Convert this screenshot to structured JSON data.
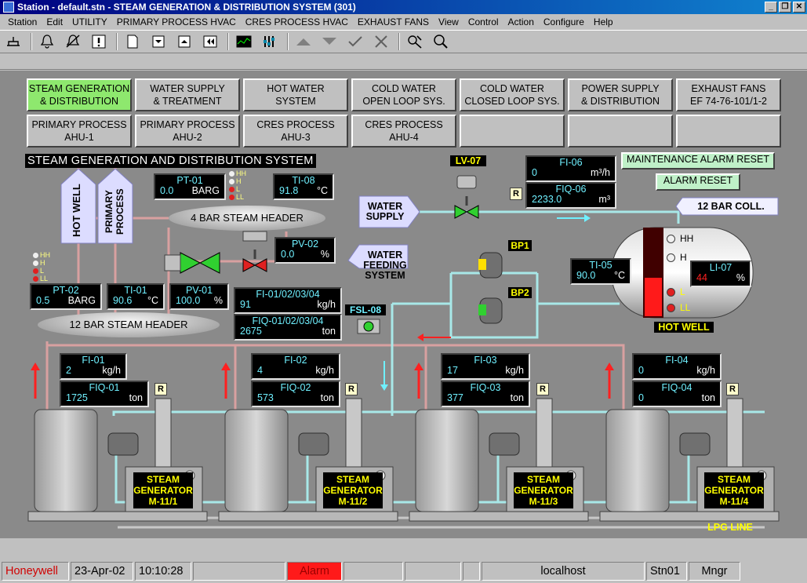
{
  "window": {
    "title": "Station - default.stn - STEAM GENERATION & DISTRIBUTION SYSTEM (301)",
    "controls": [
      "_",
      "❐",
      "✕"
    ]
  },
  "menu": [
    "Station",
    "Edit",
    "UTILITY",
    "PRIMARY PROCESS HVAC",
    "CRES PROCESS HVAC",
    "EXHAUST FANS",
    "View",
    "Control",
    "Action",
    "Configure",
    "Help"
  ],
  "toolbar": [
    "network-icon",
    "bell-icon",
    "bell-mute-icon",
    "alert-icon",
    "page-icon",
    "page-down-icon",
    "page-up-icon",
    "page-back-icon",
    "trend-icon",
    "bars-icon",
    "arrow-up-icon",
    "arrow-down-icon",
    "check-icon",
    "cross-icon",
    "detail-icon",
    "search-icon"
  ],
  "nav": {
    "row1": [
      "STEAM GENERATION\n& DISTRIBUTION",
      "WATER SUPPLY\n& TREATMENT",
      "HOT WATER\nSYSTEM",
      "COLD WATER\nOPEN LOOP SYS.",
      "COLD WATER\nCLOSED LOOP SYS.",
      "POWER SUPPLY\n& DISTRIBUTION",
      "EXHAUST FANS\nEF 74-76-101/1-2"
    ],
    "row2": [
      "PRIMARY PROCESS\nAHU-1",
      "PRIMARY PROCESS\nAHU-2",
      "CRES PROCESS\nAHU-3",
      "CRES PROCESS\nAHU-4",
      "",
      "",
      ""
    ]
  },
  "system_title": "STEAM GENERATION AND DISTRIBUTION SYSTEM",
  "buttons": {
    "maint_reset": "MAINTENANCE ALARM RESET",
    "alarm_reset": "ALARM RESET"
  },
  "labels": {
    "hot_well_arrow": "HOT WELL",
    "primary_process_arrow": "PRIMARY PROCESS",
    "header_4bar": "4 BAR STEAM HEADER",
    "header_12bar": "12 BAR STEAM HEADER",
    "water_supply": "WATER\nSUPPLY",
    "water_feeding": "WATER\nFEEDING\nSYSTEM",
    "coll_12bar": "12 BAR COLL.",
    "lv07": "LV-07",
    "bp1": "BP1",
    "bp2": "BP2",
    "fsl08": "FSL-08",
    "hot_well": "HOT WELL",
    "lpg_line": "LPG LINE",
    "r": "R"
  },
  "alarm_levels": [
    "HH",
    "H",
    "L",
    "LL"
  ],
  "instruments": {
    "pt01": {
      "tag": "PT-01",
      "value": "0.0",
      "unit": "BARG"
    },
    "ti08": {
      "tag": "TI-08",
      "value": "91.8",
      "unit": "°C"
    },
    "pv02": {
      "tag": "PV-02",
      "value": "0.0",
      "unit": "%"
    },
    "pt02": {
      "tag": "PT-02",
      "value": "0.5",
      "unit": "BARG"
    },
    "ti01": {
      "tag": "TI-01",
      "value": "90.6",
      "unit": "°C"
    },
    "pv01": {
      "tag": "PV-01",
      "value": "100.0",
      "unit": "%"
    },
    "fi0104": {
      "tag": "FI-01/02/03/04",
      "value": "91",
      "unit": "kg/h"
    },
    "fiq0104": {
      "tag": "FIQ-01/02/03/04",
      "value": "2675",
      "unit": "ton"
    },
    "fi06": {
      "tag": "FI-06",
      "value": "0",
      "unit": "m³/h"
    },
    "fiq06": {
      "tag": "FIQ-06",
      "value": "2233.0",
      "unit": "m³"
    },
    "ti05": {
      "tag": "TI-05",
      "value": "90.0",
      "unit": "°C"
    },
    "li07": {
      "tag": "LI-07",
      "value": "44",
      "unit": "%"
    },
    "fi01": {
      "tag": "FI-01",
      "value": "2",
      "unit": "kg/h"
    },
    "fiq01": {
      "tag": "FIQ-01",
      "value": "1725",
      "unit": "ton"
    },
    "fi02": {
      "tag": "FI-02",
      "value": "4",
      "unit": "kg/h"
    },
    "fiq02": {
      "tag": "FIQ-02",
      "value": "573",
      "unit": "ton"
    },
    "fi03": {
      "tag": "FI-03",
      "value": "17",
      "unit": "kg/h"
    },
    "fiq03": {
      "tag": "FIQ-03",
      "value": "377",
      "unit": "ton"
    },
    "fi04": {
      "tag": "FI-04",
      "value": "0",
      "unit": "kg/h"
    },
    "fiq04": {
      "tag": "FIQ-04",
      "value": "0",
      "unit": "ton"
    }
  },
  "hot_well_level": 0.44,
  "generators": [
    {
      "line1": "STEAM",
      "line2": "GENERATOR",
      "line3": "M-11/1"
    },
    {
      "line1": "STEAM",
      "line2": "GENERATOR",
      "line3": "M-11/2"
    },
    {
      "line1": "STEAM",
      "line2": "GENERATOR",
      "line3": "M-11/3"
    },
    {
      "line1": "STEAM",
      "line2": "GENERATOR",
      "line3": "M-11/4"
    }
  ],
  "status": {
    "brand": "Honeywell",
    "date": "23-Apr-02",
    "time": "10:10:28",
    "alarm": "Alarm",
    "host": "localhost",
    "station": "Stn01",
    "level": "Mngr"
  },
  "colors": {
    "active_nav": "#8ee86e",
    "steam_pipe": "#d8a0a0",
    "water_pipe": "#a8e8e8",
    "alarm_red": "#ff1a1a",
    "brand_red": "#d00000"
  }
}
